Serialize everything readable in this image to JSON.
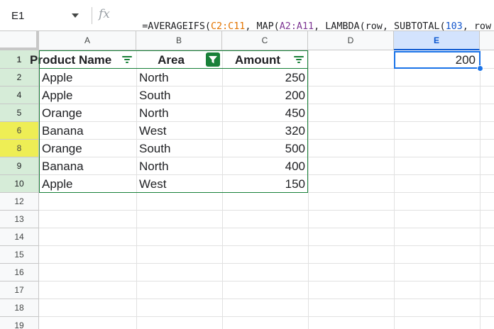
{
  "name_box": {
    "ref": "E1"
  },
  "formula_bar": {
    "fx_label": "fx",
    "tokens": [
      {
        "text": "=AVERAGEIFS(",
        "color": "default"
      },
      {
        "text": "C2:C11",
        "color": "orange"
      },
      {
        "text": ", MAP(",
        "color": "default"
      },
      {
        "text": "A2:A11",
        "color": "purple"
      },
      {
        "text": ", LAMBDA(row, SUBTOTAL(",
        "color": "default"
      },
      {
        "text": "103",
        "color": "blue"
      },
      {
        "text": ", row",
        "color": "default"
      }
    ]
  },
  "columns": [
    {
      "label": "A",
      "selected": false
    },
    {
      "label": "B",
      "selected": false
    },
    {
      "label": "C",
      "selected": false
    },
    {
      "label": "D",
      "selected": false
    },
    {
      "label": "E",
      "selected": true
    }
  ],
  "rows": [
    {
      "label": "1",
      "style": "header"
    },
    {
      "label": "2",
      "style": "filtered"
    },
    {
      "label": "4",
      "style": "filtered"
    },
    {
      "label": "5",
      "style": "filtered"
    },
    {
      "label": "6",
      "style": "highlight"
    },
    {
      "label": "8",
      "style": "highlight"
    },
    {
      "label": "9",
      "style": "filtered"
    },
    {
      "label": "10",
      "style": "filtered"
    },
    {
      "label": "12",
      "style": "normal"
    },
    {
      "label": "13",
      "style": "normal"
    },
    {
      "label": "14",
      "style": "normal"
    },
    {
      "label": "15",
      "style": "normal"
    },
    {
      "label": "16",
      "style": "normal"
    },
    {
      "label": "17",
      "style": "normal"
    },
    {
      "label": "18",
      "style": "normal"
    },
    {
      "label": "19",
      "style": "normal"
    }
  ],
  "table": {
    "headers": [
      "Product Name",
      "Area",
      "Amount"
    ],
    "active_filter_column": "Area",
    "data": [
      [
        "Apple",
        "North",
        "250"
      ],
      [
        "Apple",
        "South",
        "200"
      ],
      [
        "Orange",
        "North",
        "450"
      ],
      [
        "Banana",
        "West",
        "320"
      ],
      [
        "Orange",
        "South",
        "500"
      ],
      [
        "Banana",
        "North",
        "400"
      ],
      [
        "Apple",
        "West",
        "150"
      ]
    ]
  },
  "selected_cell": {
    "ref": "E1",
    "value": "200"
  },
  "colors": {
    "accent_blue": "#1a73e8",
    "filter_green": "#188038",
    "filtered_row_header": "#d6ecd8",
    "highlight_yellow": "#eeee55",
    "selected_col_header": "#d3e3fd"
  },
  "icons": [
    "dropdown-caret-icon",
    "fx-icon",
    "filter-icon",
    "filter-active-icon"
  ]
}
